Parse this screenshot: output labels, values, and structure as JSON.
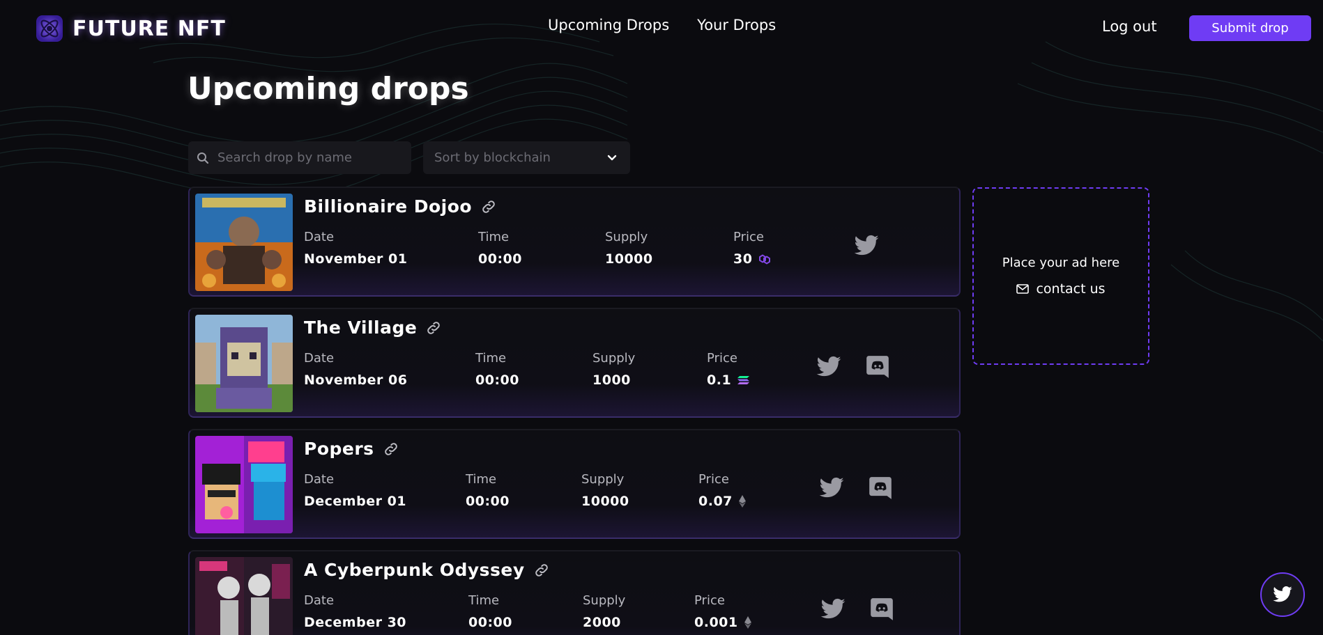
{
  "brand": {
    "name": "FUTURE NFT",
    "accent": "#6f3cf4"
  },
  "nav": {
    "items": [
      {
        "label": "Upcoming Drops"
      },
      {
        "label": "Your Drops"
      }
    ],
    "logout_label": "Log out",
    "submit_label": "Submit drop"
  },
  "page": {
    "title": "Upcoming drops"
  },
  "filters": {
    "search_placeholder": "Search drop by name",
    "sort_label": "Sort by blockchain"
  },
  "field_labels": {
    "date": "Date",
    "time": "Time",
    "supply": "Supply",
    "price": "Price"
  },
  "drops": [
    {
      "name": "Billionaire Dojoo",
      "date": "November 01",
      "time": "00:00",
      "supply": "10000",
      "price": "30",
      "chain_icon": "polygon-icon",
      "socials": [
        "twitter-icon"
      ]
    },
    {
      "name": "The Village",
      "date": "November 06",
      "time": "00:00",
      "supply": "1000",
      "price": "0.1",
      "chain_icon": "solana-icon",
      "socials": [
        "twitter-icon",
        "discord-icon"
      ]
    },
    {
      "name": "Popers",
      "date": "December 01",
      "time": "00:00",
      "supply": "10000",
      "price": "0.07",
      "chain_icon": "ethereum-icon",
      "socials": [
        "twitter-icon",
        "discord-icon"
      ]
    },
    {
      "name": "A Cyberpunk Odyssey",
      "date": "December 30",
      "time": "00:00",
      "supply": "2000",
      "price": "0.001",
      "chain_icon": "ethereum-icon",
      "socials": [
        "twitter-icon",
        "discord-icon"
      ]
    }
  ],
  "ad": {
    "text": "Place your ad here",
    "contact_label": "contact us"
  }
}
